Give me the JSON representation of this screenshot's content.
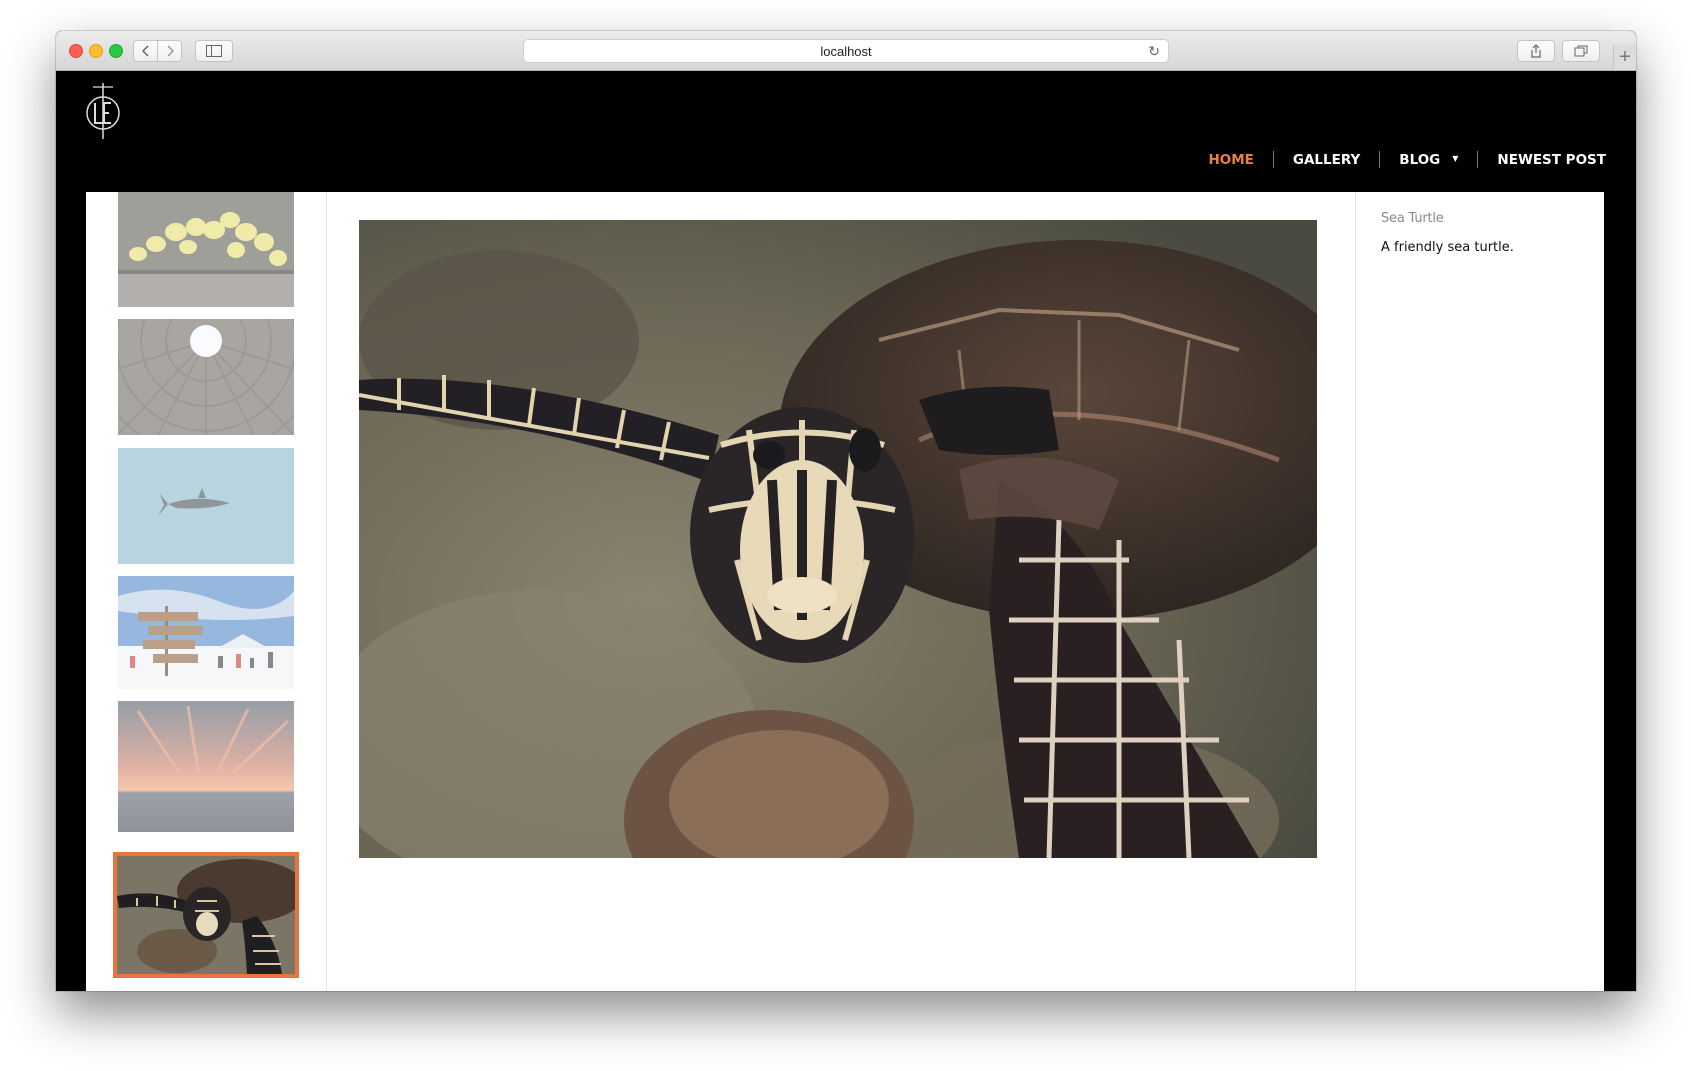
{
  "browser": {
    "url": "localhost"
  },
  "site": {
    "logo_name": "LE"
  },
  "nav": {
    "items": [
      {
        "label": "HOME",
        "active": true
      },
      {
        "label": "GALLERY",
        "active": false
      },
      {
        "label": "BLOG",
        "active": false,
        "has_dropdown": true
      },
      {
        "label": "NEWEST POST",
        "active": false
      }
    ]
  },
  "gallery": {
    "thumbnails": [
      {
        "subject": "yellow orchids",
        "selected": false
      },
      {
        "subject": "pantheon dome oculus",
        "selected": false
      },
      {
        "subject": "shark in blue water",
        "selected": false
      },
      {
        "subject": "snowy signpost with skiers",
        "selected": false
      },
      {
        "subject": "sunset over sea",
        "selected": false
      },
      {
        "subject": "sea turtle",
        "selected": true
      }
    ],
    "selected_title": "Sea Turtle",
    "selected_description": "A friendly sea turtle."
  },
  "colors": {
    "accent": "#e9743c",
    "header_bg": "#000000"
  }
}
